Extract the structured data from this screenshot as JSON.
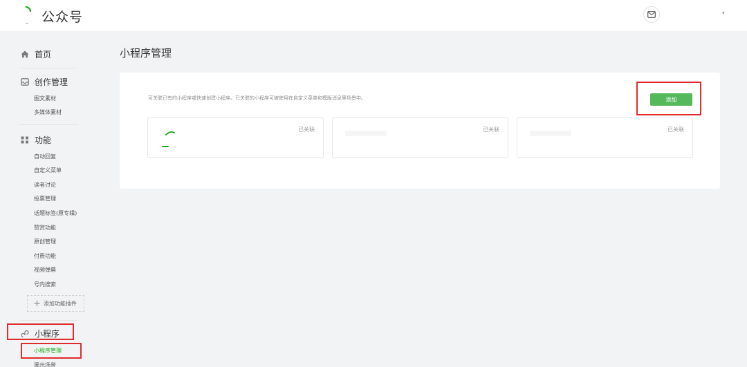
{
  "header": {
    "brand": "公众号",
    "user_name": "",
    "caret": "▾"
  },
  "sidebar": {
    "home": "首页",
    "sections": [
      {
        "title": "创作管理",
        "items": [
          "图文素材",
          "多媒体素材"
        ]
      },
      {
        "title": "功能",
        "items": [
          "自动回复",
          "自定义菜单",
          "读者讨论",
          "投票管理",
          "话题标签(原专辑)",
          "赞赏功能",
          "原创管理",
          "付费功能",
          "视频弹幕",
          "号内搜索"
        ]
      },
      {
        "title": "小程序",
        "items": [
          "小程序管理",
          "展示场景"
        ]
      }
    ],
    "add_plugin": "添加功能插件"
  },
  "main": {
    "title": "小程序管理",
    "description": "可关联已有的小程序或快速创建小程序。已关联的小程序可被使用在自定义菜单和模版消息等场景中。",
    "add_button": "添加",
    "cards": [
      {
        "status": "已关联"
      },
      {
        "status": "已关联"
      },
      {
        "status": "已关联"
      }
    ]
  },
  "colors": {
    "accent_green": "#53b95b",
    "highlight_red": "#e02c2c"
  }
}
